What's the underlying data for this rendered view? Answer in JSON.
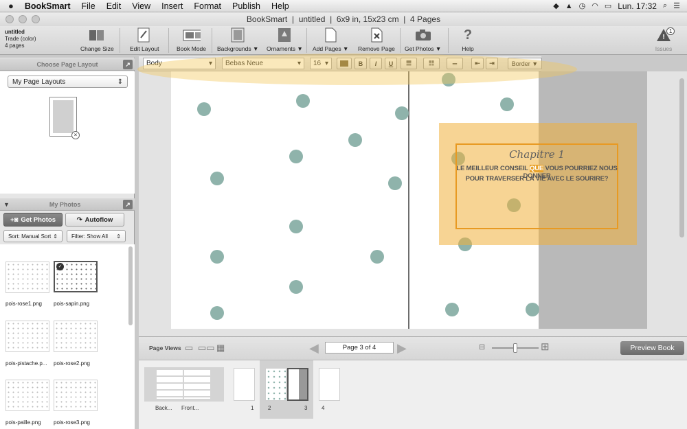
{
  "menubar": {
    "app_name": "BookSmart",
    "items": [
      "File",
      "Edit",
      "View",
      "Insert",
      "Format",
      "Publish",
      "Help"
    ],
    "clock": "Lun. 17:32"
  },
  "titlebar": {
    "title": "BookSmart  |  untitled  |  6x9 in, 15x23 cm  |  4 Pages"
  },
  "docinfo": {
    "name": "untitled",
    "type": "Trade (color)",
    "pages": "4 pages"
  },
  "toolbar": {
    "change_size": "Change Size",
    "edit_layout": "Edit Layout",
    "book_mode": "Book Mode",
    "backgrounds": "Backgrounds ▼",
    "ornaments": "Ornaments ▼",
    "add_pages": "Add Pages ▼",
    "remove_page": "Remove Page",
    "get_photos": "Get Photos ▼",
    "help": "Help",
    "issues": "Issues",
    "issues_count": "1"
  },
  "layout_panel": {
    "title": "Choose Page Layout",
    "dropdown": "My Page Layouts"
  },
  "photos_panel": {
    "title": "My Photos",
    "get_photos": "Get Photos",
    "autoflow": "Autoflow",
    "sort": "Sort:  Manual Sort",
    "filter": "Filter: Show All",
    "photos": [
      {
        "name": "pois-rose1.png"
      },
      {
        "name": "pois-sapin.png"
      },
      {
        "name": "pois-pistache.p..."
      },
      {
        "name": "pois-rose2.png"
      },
      {
        "name": "pois-paille.png"
      },
      {
        "name": "pois-rose3.png"
      }
    ]
  },
  "formatbar": {
    "style": "Body",
    "font": "Bebas Neue",
    "size": "16",
    "bold": "B",
    "italic": "I",
    "underline": "U",
    "border": "Border ▼"
  },
  "page_content": {
    "chapter": "Chapitre 1",
    "quote_line1_before": "LE MEILLEUR CONSEIL ",
    "quote_line1_selected": "QUE",
    "quote_line1_after": " VOUS POURRIEZ NOUS DONNER",
    "quote_line2": "POUR TRAVERSER LA VIE AVEC LE SOURIRE?"
  },
  "bottom": {
    "page_views": "Page Views",
    "page_indicator": "Page 3 of 4",
    "preview": "Preview Book"
  },
  "strip": {
    "labels": {
      "back": "Back...",
      "front": "Front...",
      "p1": "1",
      "p2": "2",
      "p3": "3",
      "p4": "4"
    }
  },
  "colors": {
    "dot": "#8fb3ab",
    "highlight": "#f3c95c",
    "selection": "#e8a22b"
  }
}
